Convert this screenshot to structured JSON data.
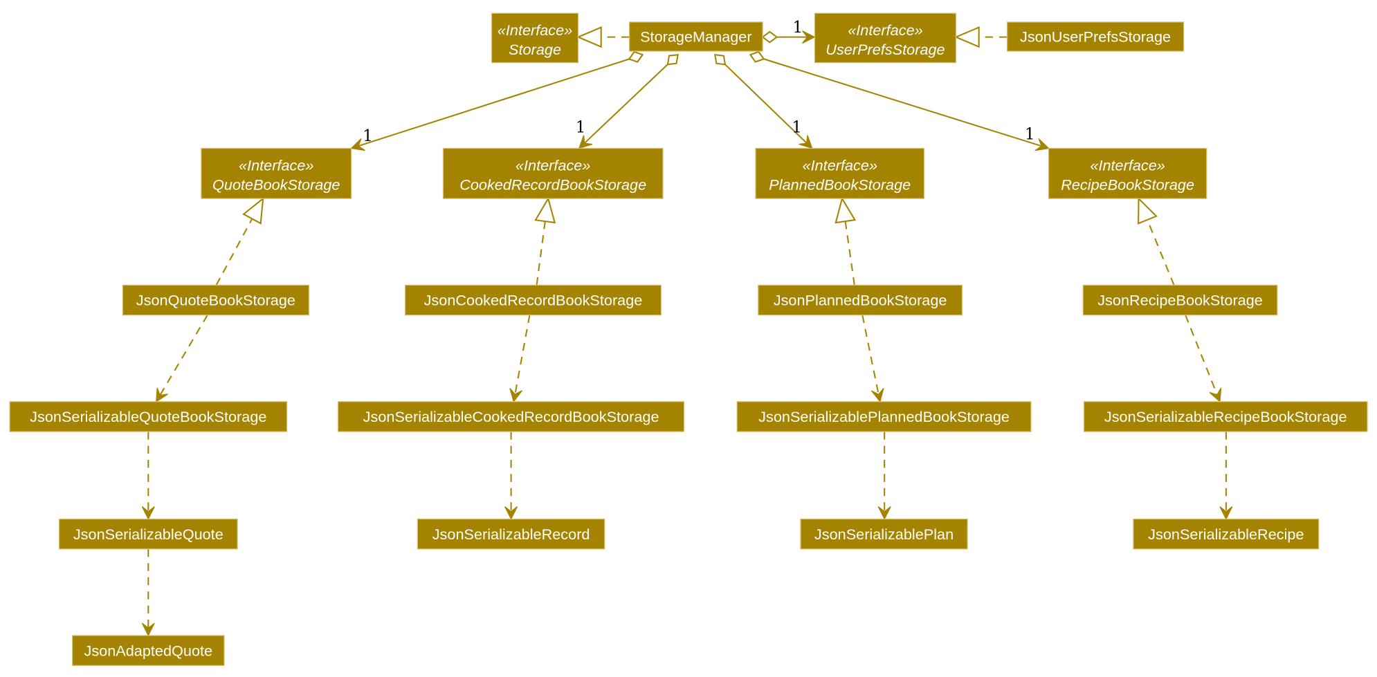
{
  "diagram": {
    "type": "uml-class-diagram",
    "colors": {
      "box_fill": "#A48300",
      "box_border": "#D9C27A",
      "box_text": "#FFFFFF",
      "edge": "#A48300",
      "multiplicity_text": "#000000"
    },
    "stereotype_label": "«Interface»",
    "nodes": [
      {
        "id": "storage",
        "name": "Storage",
        "interface": true
      },
      {
        "id": "storageManager",
        "name": "StorageManager",
        "interface": false
      },
      {
        "id": "userPrefsStorage",
        "name": "UserPrefsStorage",
        "interface": true
      },
      {
        "id": "jsonUserPrefsStorage",
        "name": "JsonUserPrefsStorage",
        "interface": false
      },
      {
        "id": "quoteBookStorage",
        "name": "QuoteBookStorage",
        "interface": true
      },
      {
        "id": "cookedRecordBookStorage",
        "name": "CookedRecordBookStorage",
        "interface": true
      },
      {
        "id": "plannedBookStorage",
        "name": "PlannedBookStorage",
        "interface": true
      },
      {
        "id": "recipeBookStorage",
        "name": "RecipeBookStorage",
        "interface": true
      },
      {
        "id": "jsonQuoteBookStorage",
        "name": "JsonQuoteBookStorage",
        "interface": false
      },
      {
        "id": "jsonCookedRecordBookStorage",
        "name": "JsonCookedRecordBookStorage",
        "interface": false
      },
      {
        "id": "jsonPlannedBookStorage",
        "name": "JsonPlannedBookStorage",
        "interface": false
      },
      {
        "id": "jsonRecipeBookStorage",
        "name": "JsonRecipeBookStorage",
        "interface": false
      },
      {
        "id": "jsonSerializableQuoteBookStorage",
        "name": "JsonSerializableQuoteBookStorage",
        "interface": false
      },
      {
        "id": "jsonSerializableCookedRecordBookStorage",
        "name": "JsonSerializableCookedRecordBookStorage",
        "interface": false
      },
      {
        "id": "jsonSerializablePlannedBookStorage",
        "name": "JsonSerializablePlannedBookStorage",
        "interface": false
      },
      {
        "id": "jsonSerializableRecipeBookStorage",
        "name": "JsonSerializableRecipeBookStorage",
        "interface": false
      },
      {
        "id": "jsonSerializableQuote",
        "name": "JsonSerializableQuote",
        "interface": false
      },
      {
        "id": "jsonSerializableRecord",
        "name": "JsonSerializableRecord",
        "interface": false
      },
      {
        "id": "jsonSerializablePlan",
        "name": "JsonSerializablePlan",
        "interface": false
      },
      {
        "id": "jsonSerializableRecipe",
        "name": "JsonSerializableRecipe",
        "interface": false
      },
      {
        "id": "jsonAdaptedQuote",
        "name": "JsonAdaptedQuote",
        "interface": false
      }
    ],
    "edges": [
      {
        "from": "storageManager",
        "to": "storage",
        "kind": "realization"
      },
      {
        "from": "storageManager",
        "to": "userPrefsStorage",
        "kind": "aggregation",
        "multiplicity": "1"
      },
      {
        "from": "jsonUserPrefsStorage",
        "to": "userPrefsStorage",
        "kind": "realization"
      },
      {
        "from": "storageManager",
        "to": "quoteBookStorage",
        "kind": "aggregation",
        "multiplicity": "1"
      },
      {
        "from": "storageManager",
        "to": "cookedRecordBookStorage",
        "kind": "aggregation",
        "multiplicity": "1"
      },
      {
        "from": "storageManager",
        "to": "plannedBookStorage",
        "kind": "aggregation",
        "multiplicity": "1"
      },
      {
        "from": "storageManager",
        "to": "recipeBookStorage",
        "kind": "aggregation",
        "multiplicity": "1"
      },
      {
        "from": "jsonQuoteBookStorage",
        "to": "quoteBookStorage",
        "kind": "realization"
      },
      {
        "from": "jsonCookedRecordBookStorage",
        "to": "cookedRecordBookStorage",
        "kind": "realization"
      },
      {
        "from": "jsonPlannedBookStorage",
        "to": "plannedBookStorage",
        "kind": "realization"
      },
      {
        "from": "jsonRecipeBookStorage",
        "to": "recipeBookStorage",
        "kind": "realization"
      },
      {
        "from": "jsonQuoteBookStorage",
        "to": "jsonSerializableQuoteBookStorage",
        "kind": "dependency"
      },
      {
        "from": "jsonCookedRecordBookStorage",
        "to": "jsonSerializableCookedRecordBookStorage",
        "kind": "dependency"
      },
      {
        "from": "jsonPlannedBookStorage",
        "to": "jsonSerializablePlannedBookStorage",
        "kind": "dependency"
      },
      {
        "from": "jsonRecipeBookStorage",
        "to": "jsonSerializableRecipeBookStorage",
        "kind": "dependency"
      },
      {
        "from": "jsonSerializableQuoteBookStorage",
        "to": "jsonSerializableQuote",
        "kind": "dependency"
      },
      {
        "from": "jsonSerializableCookedRecordBookStorage",
        "to": "jsonSerializableRecord",
        "kind": "dependency"
      },
      {
        "from": "jsonSerializablePlannedBookStorage",
        "to": "jsonSerializablePlan",
        "kind": "dependency"
      },
      {
        "from": "jsonSerializableRecipeBookStorage",
        "to": "jsonSerializableRecipe",
        "kind": "dependency"
      },
      {
        "from": "jsonSerializableQuote",
        "to": "jsonAdaptedQuote",
        "kind": "dependency"
      }
    ]
  }
}
